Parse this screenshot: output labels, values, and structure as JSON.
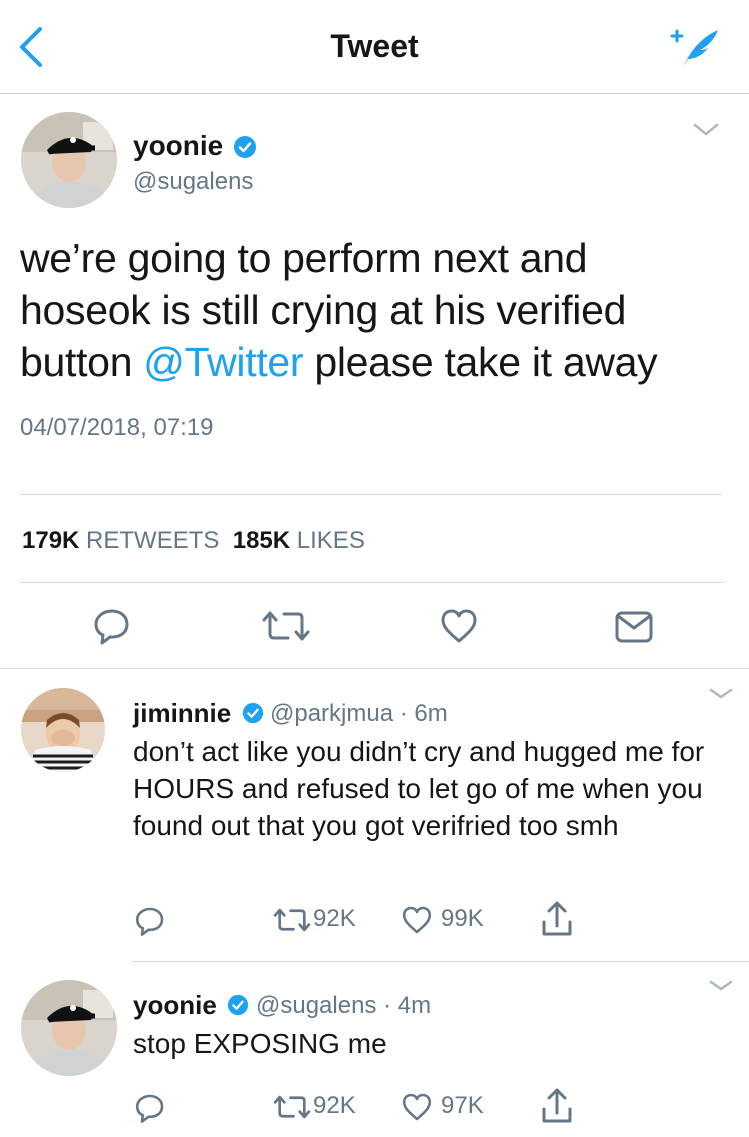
{
  "nav": {
    "title": "Tweet",
    "back_icon": "chevron-left-icon",
    "compose_icon": "compose-tweet-icon"
  },
  "colors": {
    "accent": "#1da1f2",
    "text": "#14171a",
    "secondary": "#657786",
    "divider": "#d7dbdf"
  },
  "main_tweet": {
    "name": "yoonie",
    "handle": "@sugalens",
    "text_before": "we’re going to perform next and hoseok is still crying at his verified button ",
    "mention": "@Twitter",
    "text_after": " please take it away",
    "timestamp": "04/07/2018, 07:19",
    "retweets_count": "179K",
    "retweets_label": "RETWEETS",
    "likes_count": "185K",
    "likes_label": "LIKES",
    "actions": [
      "reply-icon",
      "retweet-icon",
      "like-icon",
      "direct-message-icon"
    ]
  },
  "replies": [
    {
      "name": "jiminnie",
      "handle": "@parkjmua",
      "time": "6m",
      "meta": "@parkjmua · 6m",
      "text": "don’t act like you didn’t cry and hugged me for HOURS and refused to let go of me when you found out that you got verifried too smh",
      "retweets": "92K",
      "likes": "99K"
    },
    {
      "name": "yoonie",
      "handle": "@sugalens",
      "time": "4m",
      "meta": "@sugalens · 4m",
      "text": "stop EXPOSING me",
      "retweets": "92K",
      "likes": "97K"
    }
  ]
}
